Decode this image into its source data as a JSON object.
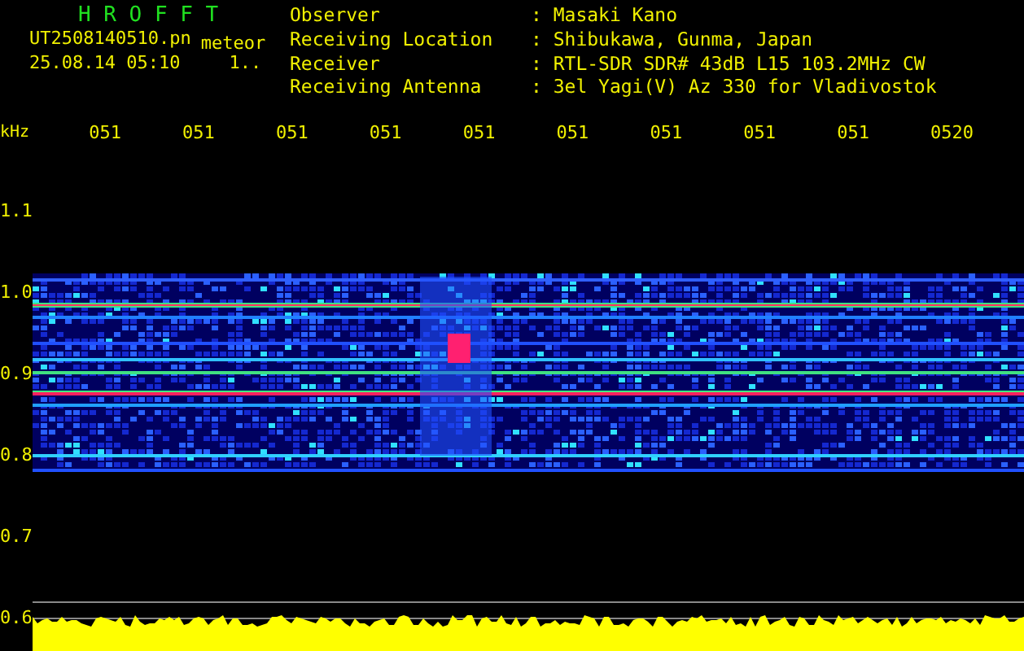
{
  "app": {
    "title": "H R O F F T",
    "file_name": "UT2508140510.pn",
    "detection": "meteor",
    "timestamp": "25.08.14 05:10",
    "counter": "1.."
  },
  "station": [
    {
      "label": "Observer",
      "value": ": Masaki Kano"
    },
    {
      "label": "Receiving Location",
      "value": ": Shibukawa, Gunma, Japan"
    },
    {
      "label": "Receiver",
      "value": ": RTL-SDR SDR# 43dB L15 103.2MHz CW"
    },
    {
      "label": "Receiving Antenna",
      "value": ": 3el Yagi(V) Az 330 for Vladivostok"
    }
  ],
  "spectrogram": {
    "y_unit": "kHz",
    "y_labels": [
      "1.1",
      "1.0",
      "0.9",
      "0.8",
      "0.7",
      "0.6"
    ],
    "x_labels": [
      "051",
      "051",
      "051",
      "051",
      "051",
      "051",
      "051",
      "051",
      "051",
      "0520"
    ]
  }
}
